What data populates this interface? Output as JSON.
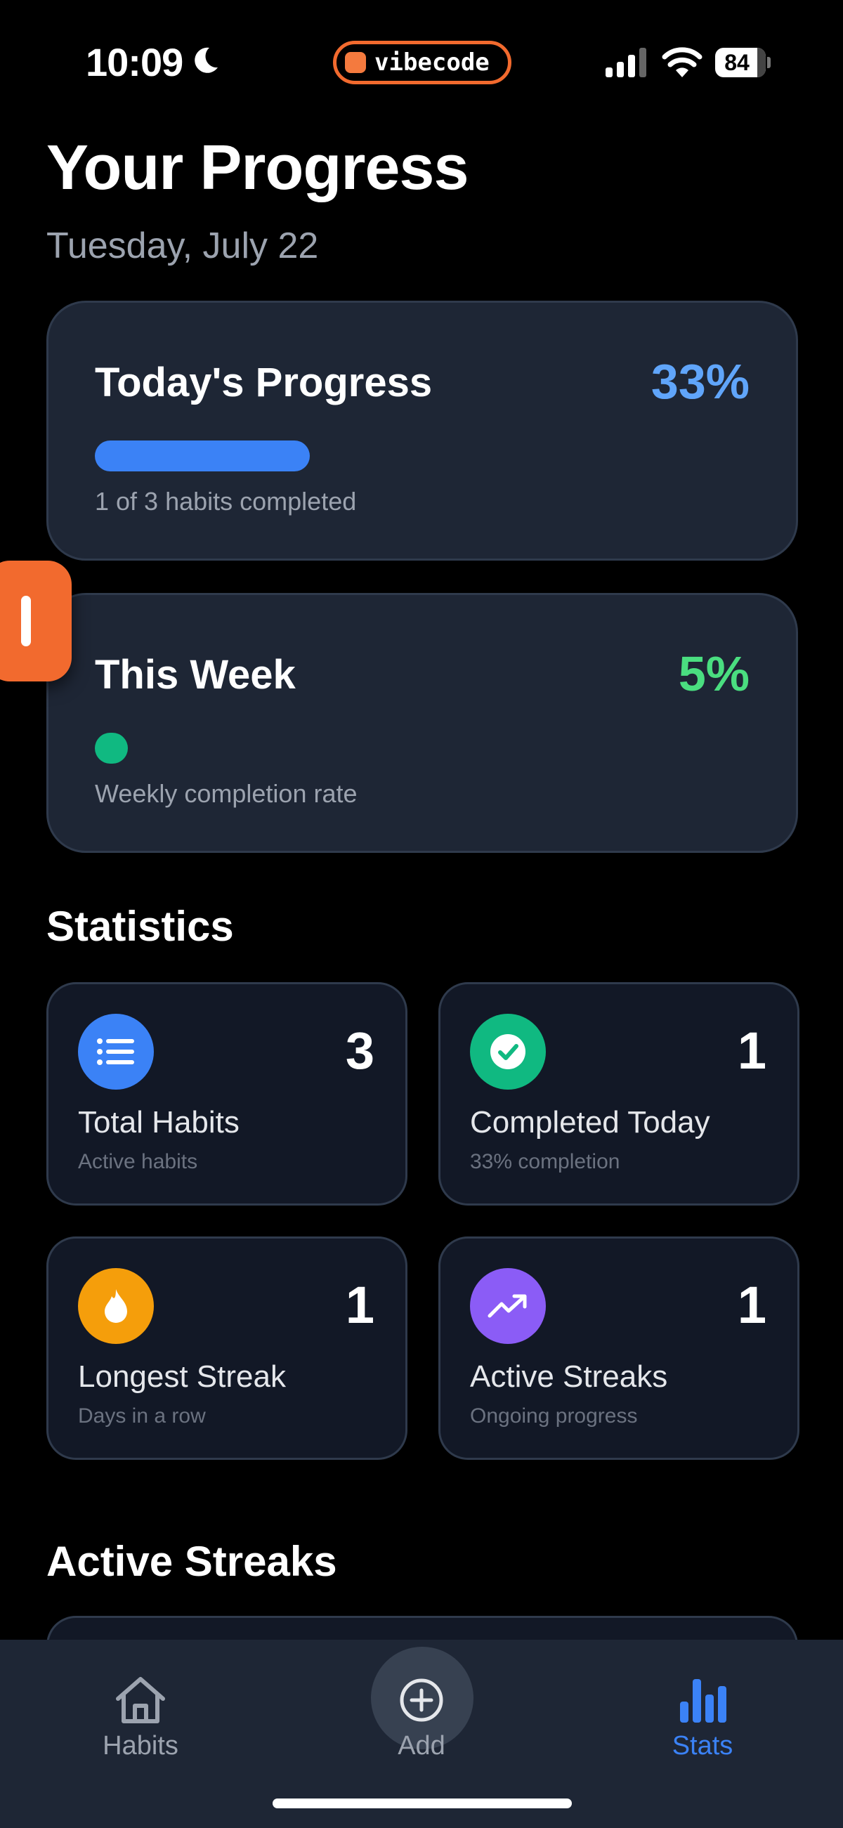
{
  "status_bar": {
    "time": "10:09",
    "app_pill": "vibecode",
    "battery": "84",
    "icons": [
      "moon-icon",
      "signal-icon",
      "wifi-icon",
      "battery-icon"
    ]
  },
  "header": {
    "title": "Your Progress",
    "date": "Tuesday, July 22"
  },
  "today": {
    "title": "Today's Progress",
    "percent": "33%",
    "progress": 0.33,
    "subtitle": "1 of 3 habits completed",
    "accent": "#3b82f6"
  },
  "week": {
    "title": "This Week",
    "percent": "5%",
    "progress": 0.05,
    "subtitle": "Weekly completion rate",
    "accent": "#22c55e",
    "bar_color": "#10b981"
  },
  "statistics": {
    "title": "Statistics",
    "cards": [
      {
        "value": "3",
        "label": "Total Habits",
        "sub": "Active habits",
        "icon": "list-icon",
        "color": "#3b82f6"
      },
      {
        "value": "1",
        "label": "Completed Today",
        "sub": "33% completion",
        "icon": "check-circle-icon",
        "color": "#10b981"
      },
      {
        "value": "1",
        "label": "Longest Streak",
        "sub": "Days in a row",
        "icon": "flame-icon",
        "color": "#f59e0b"
      },
      {
        "value": "1",
        "label": "Active Streaks",
        "sub": "Ongoing progress",
        "icon": "trending-up-icon",
        "color": "#8b5cf6"
      }
    ]
  },
  "active_streaks": {
    "title": "Active Streaks"
  },
  "tab_bar": {
    "tabs": [
      {
        "label": "Habits",
        "icon": "home-icon"
      },
      {
        "label": "Add",
        "icon": "plus-circle-icon"
      },
      {
        "label": "Stats",
        "icon": "bar-chart-icon",
        "active": true
      }
    ],
    "active_color": "#3b82f6"
  }
}
